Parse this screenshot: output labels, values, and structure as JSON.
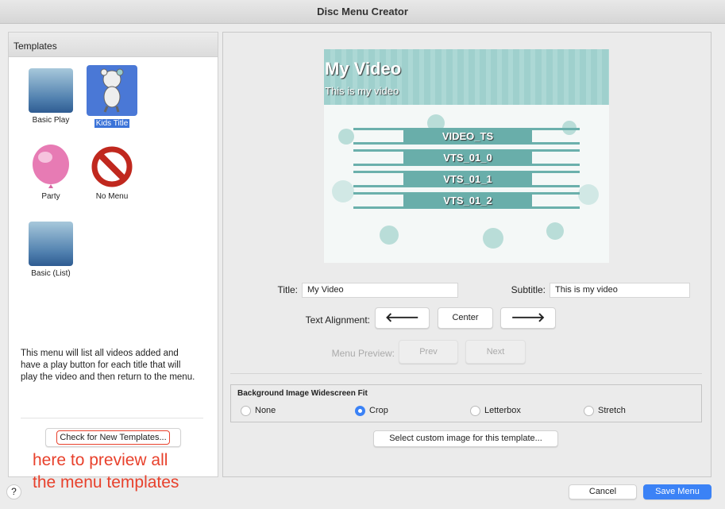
{
  "window": {
    "title": "Disc Menu Creator"
  },
  "templates": {
    "header": "Templates",
    "items": [
      {
        "label": "Basic Play",
        "icon": "gradient-icon"
      },
      {
        "label": "Kids Title",
        "icon": "teddy-bear-icon",
        "selected": true
      },
      {
        "label": "Party",
        "icon": "balloon-icon"
      },
      {
        "label": "No Menu",
        "icon": "no-symbol-icon"
      },
      {
        "label": "Basic (List)",
        "icon": "gradient-icon"
      }
    ],
    "description": "This menu will list all videos added and have a play button for each title that will play the video and then return to the menu.",
    "check_button": "Check for New Templates...",
    "annotation_line1": "here to preview all",
    "annotation_line2": "the menu templates",
    "annotation_color": "#e8412c"
  },
  "preview": {
    "title": "My Video",
    "subtitle": "This is my video",
    "items": [
      "VIDEO_TS",
      "VTS_01_0",
      "VTS_01_1",
      "VTS_01_2"
    ]
  },
  "form": {
    "title_label": "Title:",
    "title_value": "My Video",
    "subtitle_label": "Subtitle:",
    "subtitle_value": "This is my video",
    "alignment_label": "Text Alignment:",
    "align_left": "🡐",
    "align_center": "Center",
    "align_right": "🡒",
    "menu_preview_label": "Menu Preview:",
    "prev": "Prev",
    "next": "Next"
  },
  "fit": {
    "legend": "Background Image Widescreen Fit",
    "options": [
      "None",
      "Crop",
      "Letterbox",
      "Stretch"
    ],
    "selected": "Crop"
  },
  "custom_image_button": "Select custom image for this template...",
  "footer": {
    "help": "?",
    "cancel": "Cancel",
    "save": "Save Menu",
    "accent": "#3b82f6"
  }
}
